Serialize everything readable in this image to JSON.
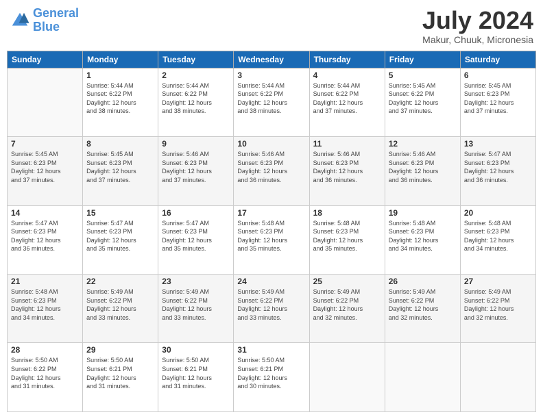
{
  "logo": {
    "line1": "General",
    "line2": "Blue"
  },
  "title": "July 2024",
  "subtitle": "Makur, Chuuk, Micronesia",
  "days_header": [
    "Sunday",
    "Monday",
    "Tuesday",
    "Wednesday",
    "Thursday",
    "Friday",
    "Saturday"
  ],
  "weeks": [
    [
      {
        "num": "",
        "info": ""
      },
      {
        "num": "1",
        "info": "Sunrise: 5:44 AM\nSunset: 6:22 PM\nDaylight: 12 hours\nand 38 minutes."
      },
      {
        "num": "2",
        "info": "Sunrise: 5:44 AM\nSunset: 6:22 PM\nDaylight: 12 hours\nand 38 minutes."
      },
      {
        "num": "3",
        "info": "Sunrise: 5:44 AM\nSunset: 6:22 PM\nDaylight: 12 hours\nand 38 minutes."
      },
      {
        "num": "4",
        "info": "Sunrise: 5:44 AM\nSunset: 6:22 PM\nDaylight: 12 hours\nand 37 minutes."
      },
      {
        "num": "5",
        "info": "Sunrise: 5:45 AM\nSunset: 6:22 PM\nDaylight: 12 hours\nand 37 minutes."
      },
      {
        "num": "6",
        "info": "Sunrise: 5:45 AM\nSunset: 6:23 PM\nDaylight: 12 hours\nand 37 minutes."
      }
    ],
    [
      {
        "num": "7",
        "info": "Sunrise: 5:45 AM\nSunset: 6:23 PM\nDaylight: 12 hours\nand 37 minutes."
      },
      {
        "num": "8",
        "info": "Sunrise: 5:45 AM\nSunset: 6:23 PM\nDaylight: 12 hours\nand 37 minutes."
      },
      {
        "num": "9",
        "info": "Sunrise: 5:46 AM\nSunset: 6:23 PM\nDaylight: 12 hours\nand 37 minutes."
      },
      {
        "num": "10",
        "info": "Sunrise: 5:46 AM\nSunset: 6:23 PM\nDaylight: 12 hours\nand 36 minutes."
      },
      {
        "num": "11",
        "info": "Sunrise: 5:46 AM\nSunset: 6:23 PM\nDaylight: 12 hours\nand 36 minutes."
      },
      {
        "num": "12",
        "info": "Sunrise: 5:46 AM\nSunset: 6:23 PM\nDaylight: 12 hours\nand 36 minutes."
      },
      {
        "num": "13",
        "info": "Sunrise: 5:47 AM\nSunset: 6:23 PM\nDaylight: 12 hours\nand 36 minutes."
      }
    ],
    [
      {
        "num": "14",
        "info": "Sunrise: 5:47 AM\nSunset: 6:23 PM\nDaylight: 12 hours\nand 36 minutes."
      },
      {
        "num": "15",
        "info": "Sunrise: 5:47 AM\nSunset: 6:23 PM\nDaylight: 12 hours\nand 35 minutes."
      },
      {
        "num": "16",
        "info": "Sunrise: 5:47 AM\nSunset: 6:23 PM\nDaylight: 12 hours\nand 35 minutes."
      },
      {
        "num": "17",
        "info": "Sunrise: 5:48 AM\nSunset: 6:23 PM\nDaylight: 12 hours\nand 35 minutes."
      },
      {
        "num": "18",
        "info": "Sunrise: 5:48 AM\nSunset: 6:23 PM\nDaylight: 12 hours\nand 35 minutes."
      },
      {
        "num": "19",
        "info": "Sunrise: 5:48 AM\nSunset: 6:23 PM\nDaylight: 12 hours\nand 34 minutes."
      },
      {
        "num": "20",
        "info": "Sunrise: 5:48 AM\nSunset: 6:23 PM\nDaylight: 12 hours\nand 34 minutes."
      }
    ],
    [
      {
        "num": "21",
        "info": "Sunrise: 5:48 AM\nSunset: 6:23 PM\nDaylight: 12 hours\nand 34 minutes."
      },
      {
        "num": "22",
        "info": "Sunrise: 5:49 AM\nSunset: 6:22 PM\nDaylight: 12 hours\nand 33 minutes."
      },
      {
        "num": "23",
        "info": "Sunrise: 5:49 AM\nSunset: 6:22 PM\nDaylight: 12 hours\nand 33 minutes."
      },
      {
        "num": "24",
        "info": "Sunrise: 5:49 AM\nSunset: 6:22 PM\nDaylight: 12 hours\nand 33 minutes."
      },
      {
        "num": "25",
        "info": "Sunrise: 5:49 AM\nSunset: 6:22 PM\nDaylight: 12 hours\nand 32 minutes."
      },
      {
        "num": "26",
        "info": "Sunrise: 5:49 AM\nSunset: 6:22 PM\nDaylight: 12 hours\nand 32 minutes."
      },
      {
        "num": "27",
        "info": "Sunrise: 5:49 AM\nSunset: 6:22 PM\nDaylight: 12 hours\nand 32 minutes."
      }
    ],
    [
      {
        "num": "28",
        "info": "Sunrise: 5:50 AM\nSunset: 6:22 PM\nDaylight: 12 hours\nand 31 minutes."
      },
      {
        "num": "29",
        "info": "Sunrise: 5:50 AM\nSunset: 6:21 PM\nDaylight: 12 hours\nand 31 minutes."
      },
      {
        "num": "30",
        "info": "Sunrise: 5:50 AM\nSunset: 6:21 PM\nDaylight: 12 hours\nand 31 minutes."
      },
      {
        "num": "31",
        "info": "Sunrise: 5:50 AM\nSunset: 6:21 PM\nDaylight: 12 hours\nand 30 minutes."
      },
      {
        "num": "",
        "info": ""
      },
      {
        "num": "",
        "info": ""
      },
      {
        "num": "",
        "info": ""
      }
    ]
  ]
}
